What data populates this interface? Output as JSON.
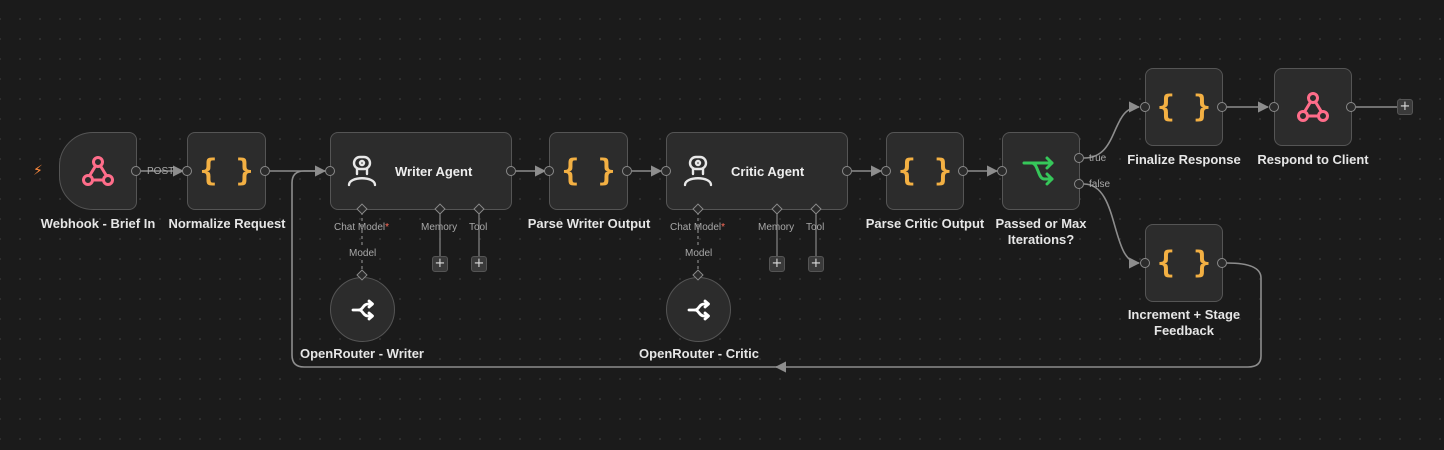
{
  "nodes": {
    "webhook_in": {
      "label": "Webhook - Brief In",
      "icon": "webhook-icon"
    },
    "normalize": {
      "label": "Normalize Request",
      "icon": "code-braces-icon"
    },
    "writer_agent": {
      "label": "Writer Agent",
      "icon": "robot-icon"
    },
    "parse_writer": {
      "label": "Parse Writer Output",
      "icon": "code-braces-icon"
    },
    "critic_agent": {
      "label": "Critic Agent",
      "icon": "robot-icon"
    },
    "parse_critic": {
      "label": "Parse Critic Output",
      "icon": "code-braces-icon"
    },
    "if_node": {
      "label_line1": "Passed or Max",
      "label_line2": "Iterations?",
      "icon": "if-branch-icon"
    },
    "finalize": {
      "label": "Finalize Response",
      "icon": "code-braces-icon"
    },
    "respond": {
      "label": "Respond to Client",
      "icon": "webhook-icon"
    },
    "increment": {
      "label_line1": "Increment + Stage",
      "label_line2": "Feedback",
      "icon": "code-braces-icon"
    },
    "openrouter_writer": {
      "label": "OpenRouter - Writer",
      "icon": "openrouter-icon"
    },
    "openrouter_critic": {
      "label": "OpenRouter - Critic",
      "icon": "openrouter-icon"
    }
  },
  "connections": {
    "post_label": "POST",
    "true_label": "true",
    "false_label": "false",
    "chat_model_label": "Chat Model",
    "required_marker": "*",
    "memory_label": "Memory",
    "tool_label": "Tool",
    "model_label": "Model",
    "add_symbol": "+"
  },
  "colors": {
    "canvas": "#1b1b1b",
    "node_bg": "#2c2c2c",
    "webhook": "#ff6d8a",
    "code": "#f3b043",
    "if_branch": "#36c75a",
    "edge": "#8d8d8d",
    "trigger_bolt": "#ff8a3d"
  }
}
